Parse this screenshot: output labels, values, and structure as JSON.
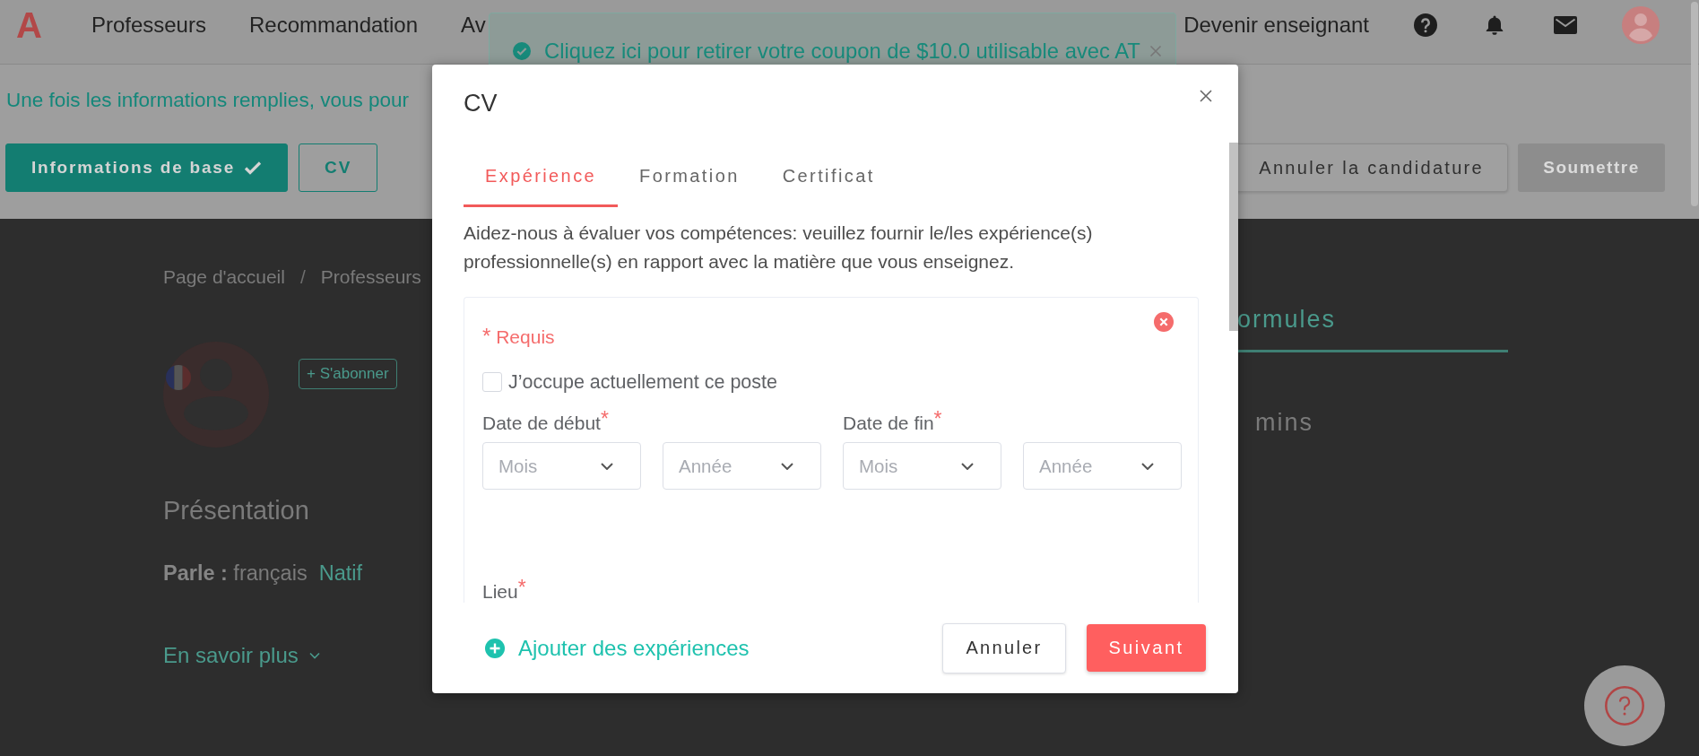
{
  "top_nav": {
    "logo": "A",
    "links": [
      "Professeurs",
      "Recommandation",
      "Av"
    ],
    "become_teacher": "Devenir enseignant"
  },
  "toast": {
    "message": "Cliquez ici pour retirer votre coupon de $10.0 utilisable avec AT"
  },
  "application_bar": {
    "notice": "Une fois les informations remplies, vous pour",
    "steps": [
      {
        "label": "Informations de base",
        "done": true
      },
      {
        "label": "CV",
        "done": false
      }
    ],
    "cancel_application": "Annuler la candidature",
    "submit": {
      "label": "Soumettre",
      "disabled": true
    }
  },
  "page": {
    "breadcrumb": [
      {
        "kind": "link",
        "text": "Page d'accueil"
      },
      {
        "kind": "separator",
        "text": "/"
      },
      {
        "kind": "link",
        "text": "Professeurs"
      }
    ],
    "follow_button": "+ S'abonner",
    "section_title": "Présentation",
    "speaks": {
      "label": "Parle :",
      "language": "français",
      "level": "Natif"
    },
    "more_link": "En savoir plus",
    "tab": {
      "label": "ormules",
      "selected": true
    },
    "duration": "mins"
  },
  "modal": {
    "title": "CV",
    "tabs": [
      {
        "label": "Expérience",
        "selected": true
      },
      {
        "label": "Formation",
        "selected": false
      },
      {
        "label": "Certificat",
        "selected": false
      }
    ],
    "description": "Aidez-nous à évaluer vos compétences: veuillez fournir le/les expérience(s) professionnelle(s) en rapport avec la matière que vous enseignez.",
    "entry": {
      "required_note": {
        "mark": "*",
        "text": "Requis"
      },
      "current_position": {
        "label": "J’occupe actuellement ce poste",
        "checked": false
      },
      "date_groups": [
        {
          "label": "Date de début",
          "mark": "*",
          "selects": [
            {
              "placeholder": "Mois"
            },
            {
              "placeholder": "Année"
            }
          ]
        },
        {
          "label": "Date de fin",
          "mark": "*",
          "selects": [
            {
              "placeholder": "Mois"
            },
            {
              "placeholder": "Année"
            }
          ]
        }
      ],
      "location": {
        "label": "Lieu",
        "mark": "*"
      }
    },
    "add_link": "Ajouter des expériences",
    "buttons": [
      {
        "label": "Annuler",
        "kind": "secondary"
      },
      {
        "label": "Suivant",
        "kind": "primary"
      }
    ]
  }
}
